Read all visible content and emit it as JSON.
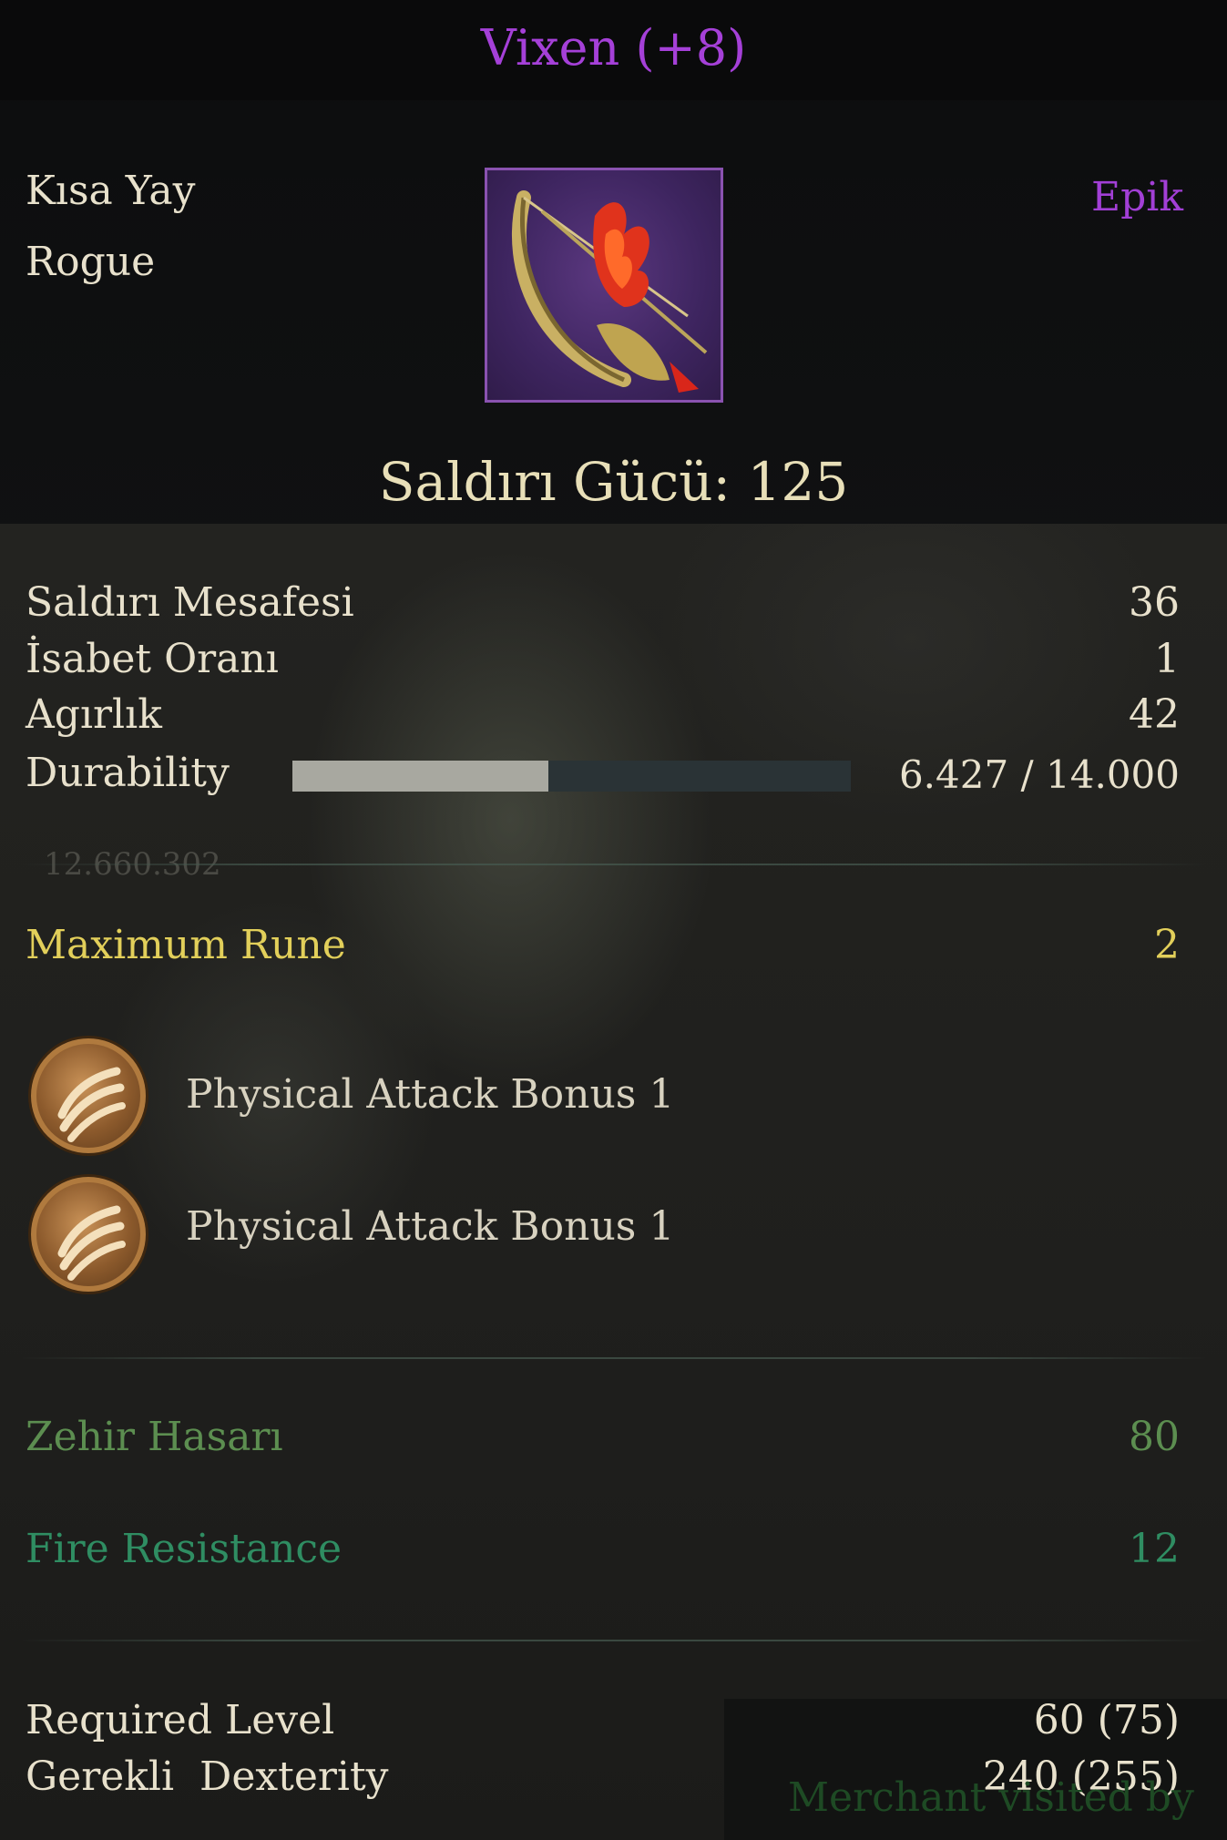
{
  "item": {
    "name": "Vixen (+8)",
    "type": "Kısa Yay",
    "class": "Rogue",
    "rarity": "Epik",
    "icon": "bow-icon",
    "attack_power": "Saldırı Gücü: 125"
  },
  "stats": [
    {
      "label": "Saldırı Mesafesi",
      "value": "36"
    },
    {
      "label": "İsabet Oranı",
      "value": "1"
    },
    {
      "label": "Agırlık",
      "value": "42"
    }
  ],
  "durability": {
    "label": "Durability",
    "value": "6.427 / 14.000",
    "fraction": 0.459
  },
  "faint_text": "12.660.302",
  "runes": {
    "label": "Maximum Rune",
    "count": "2",
    "slots": [
      {
        "icon": "physical-attack-rune-icon",
        "label": "Physical Attack Bonus 1"
      },
      {
        "icon": "physical-attack-rune-icon",
        "label": "Physical Attack Bonus 1"
      }
    ]
  },
  "bonuses": [
    {
      "label": "Zehir Hasarı",
      "value": "80"
    },
    {
      "label": "Fire Resistance",
      "value": "12"
    }
  ],
  "requirements": [
    {
      "label": "Required Level",
      "value": "60 (75)"
    },
    {
      "label": "Gerekli  Dexterity",
      "value": "240 (255)"
    }
  ],
  "footer_text": "Merchant visited by",
  "colors": {
    "title": "#a540d8",
    "rune": "#e2cf5a",
    "poison": "#5c8e50",
    "fire_res": "#2f8d62"
  }
}
